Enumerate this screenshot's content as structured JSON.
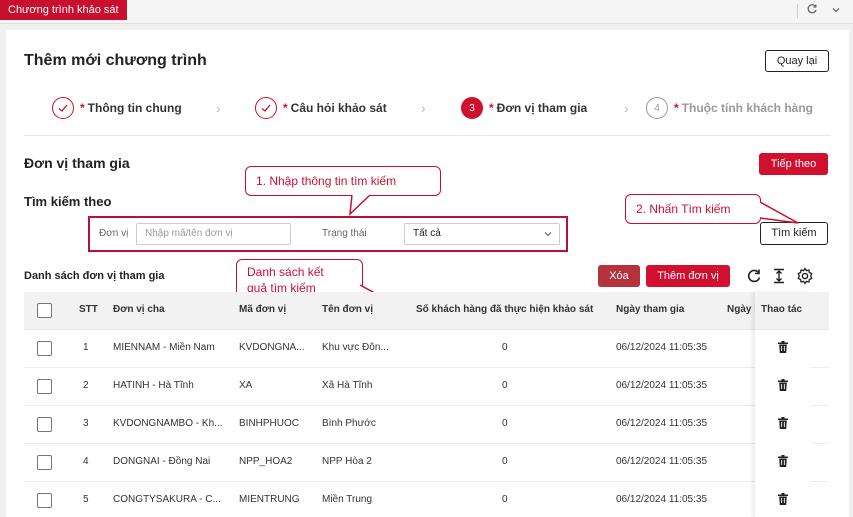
{
  "topbar": {
    "active_tab": "Chương trình khảo sát",
    "icons": [
      "refresh-icon",
      "chevron-down-icon"
    ]
  },
  "header": {
    "title": "Thêm mới chương trình",
    "back_label": "Quay lại"
  },
  "steps": [
    {
      "label": "Thông tin chung",
      "state": "done"
    },
    {
      "label": "Câu hỏi khảo sát",
      "state": "done"
    },
    {
      "number": "3",
      "label": "Đơn vị tham gia",
      "state": "active"
    },
    {
      "number": "4",
      "label": "Thuộc tính khách hàng",
      "state": "pending"
    }
  ],
  "section": {
    "title": "Đơn vị tham gia",
    "next_label": "Tiếp theo"
  },
  "search": {
    "title": "Tìm kiếm theo",
    "unit_label": "Đơn vị",
    "unit_placeholder": "Nhập mã/tên đơn vị",
    "status_label": "Trạng thái",
    "status_value": "Tất cả",
    "button_label": "Tìm kiếm"
  },
  "callouts": {
    "c1": "1. Nhập thông tin tìm kiếm",
    "c2": "2. Nhấn Tìm kiếm",
    "c3_line1": "Danh sách kết",
    "c3_line2": "quả tìm kiếm"
  },
  "list": {
    "title": "Danh sách đơn vị tham gia",
    "delete_label": "Xóa",
    "add_label": "Thêm đơn vị",
    "columns": [
      "STT",
      "Đơn vị cha",
      "Mã đơn vị",
      "Tên đơn vị",
      "Số khách hàng đã thực hiện khảo sát",
      "Ngày tham gia",
      "Ngày k",
      "Thao tác"
    ],
    "rows": [
      {
        "stt": "1",
        "parent": "MIENNAM - Miền Nam",
        "code": "KVDONGNA...",
        "name": "Khu vực Đôn...",
        "count": "0",
        "date": "06/12/2024 11:05:35"
      },
      {
        "stt": "2",
        "parent": "HATINH - Hà Tĩnh",
        "code": "XA",
        "name": "Xã Hà Tĩnh",
        "count": "0",
        "date": "06/12/2024 11:05:35"
      },
      {
        "stt": "3",
        "parent": "KVDONGNAMBO - Kh...",
        "code": "BINHPHUOC",
        "name": "Bình Phước",
        "count": "0",
        "date": "06/12/2024 11:05:35"
      },
      {
        "stt": "4",
        "parent": "DONGNAI - Đồng Nai",
        "code": "NPP_HOA2",
        "name": "NPP Hòa 2",
        "count": "0",
        "date": "06/12/2024 11:05:35"
      },
      {
        "stt": "5",
        "parent": "CONGTYSAKURA - C...",
        "code": "MIENTRUNG",
        "name": "Miền Trung",
        "count": "0",
        "date": "06/12/2024 11:05:35"
      }
    ]
  },
  "colors": {
    "accent": "#d0102d",
    "callout": "#c8102e",
    "delete": "#b3323c"
  }
}
